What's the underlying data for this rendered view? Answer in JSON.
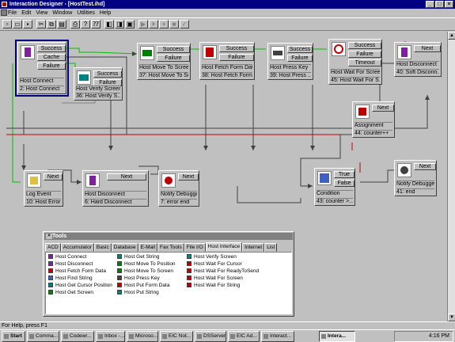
{
  "window": {
    "title": "Interaction Designer - [HostTest.ihd]"
  },
  "menu": [
    "File",
    "Edit",
    "View",
    "Window",
    "Utilities",
    "Help"
  ],
  "nodes": [
    {
      "id": "host-connect",
      "buttons": [
        "Success",
        "Cache",
        "Failure"
      ],
      "label1": "Host Connect",
      "label2": "2: Host Connect",
      "selected": true
    },
    {
      "id": "host-verify-screen",
      "buttons": [
        "Success",
        "Failure"
      ],
      "label1": "Host Verify Screen",
      "label2": "36: Host Verify S..."
    },
    {
      "id": "host-move-to-screen",
      "buttons": [
        "Success",
        "Failure"
      ],
      "label1": "Host Move To Screen",
      "label2": "37: Host Move To Screen"
    },
    {
      "id": "host-fetch-form-data",
      "buttons": [
        "Success",
        "Failure"
      ],
      "label1": "Host Fetch Form Data",
      "label2": "38: Host Fetch Form ..."
    },
    {
      "id": "host-press-key",
      "buttons": [
        "Success",
        "Failure"
      ],
      "label1": "Host Press Key",
      "label2": "39: Host Press ..."
    },
    {
      "id": "host-wait-for-screen",
      "buttons": [
        "Success",
        "Failure",
        "Timeout"
      ],
      "label1": "Host Wait For Screen",
      "label2": "45: Host Wait For S..."
    },
    {
      "id": "host-disconnect-top",
      "buttons": [
        "Next"
      ],
      "label1": "Host Disconnect",
      "label2": "40: Soft Disconn..."
    },
    {
      "id": "assignment",
      "buttons": [
        "Next"
      ],
      "label1": "Assignment",
      "label2": "44: counter++"
    },
    {
      "id": "log-event",
      "buttons": [
        "Next"
      ],
      "label1": "Log Event",
      "label2": "10: Host Error"
    },
    {
      "id": "host-disconnect-bottom",
      "buttons": [
        "Next"
      ],
      "label1": "Host Disconnect",
      "label2": "6: Hard Disconnect"
    },
    {
      "id": "notify-debugger-1",
      "buttons": [
        "Next"
      ],
      "label1": "Notify Debugger",
      "label2": "7: error end"
    },
    {
      "id": "condition",
      "buttons": [
        "True",
        "False"
      ],
      "label1": "Condition",
      "label2": "43: counter >..."
    },
    {
      "id": "notify-debugger-2",
      "buttons": [
        "Next"
      ],
      "label1": "Notify Debugger",
      "label2": "41: end"
    }
  ],
  "tools": {
    "title": "Tools",
    "tabs": [
      "ACD",
      "Accumulator",
      "Basic",
      "Database",
      "E-Mail",
      "Fax Tools",
      "File I/O",
      "Host Interface",
      "Internet",
      "List"
    ],
    "active_tab": "Host Interface",
    "col1": [
      "Host Connect",
      "Host Disconnect",
      "Host Fetch Form Data",
      "Host Find String",
      "Host Get Cursor Position",
      "Host Get Screen"
    ],
    "col2": [
      "Host Get String",
      "Host Move To Position",
      "Host Move To Screen",
      "Host Press Key",
      "Host Put Form Data",
      "Host Put String"
    ],
    "col3": [
      "Host Verify Screen",
      "Host Wait For Cursor",
      "Host Wait For ReadyToSend",
      "Host Wait For Screen",
      "Host Wait For String"
    ]
  },
  "status": "For Help, press F1",
  "taskbar": {
    "start": "Start",
    "items": [
      "Comma...",
      "Codewr...",
      "Inbox -...",
      "Microso...",
      "EIC Not...",
      "DSServer",
      "EIC Ad...",
      "Interact...",
      "Intera..."
    ],
    "active": "Intera...",
    "clock": "4:16 PM"
  },
  "colors": {
    "title": "#000080",
    "face": "#c0c0c0",
    "green_link": "#00c000",
    "red_link": "#c00000"
  }
}
